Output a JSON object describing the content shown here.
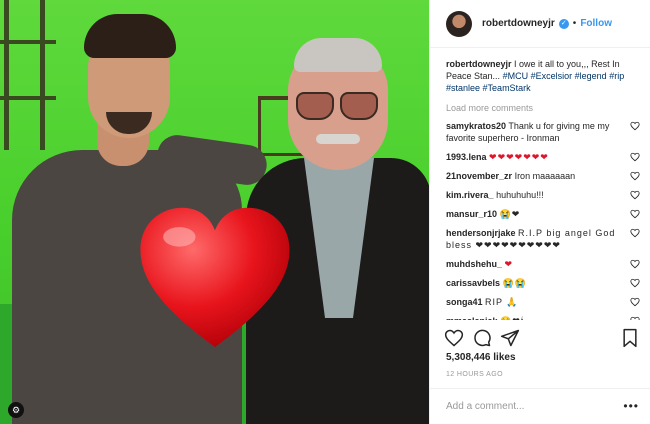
{
  "post": {
    "username": "robertdowneyjr",
    "verified_badge": "✓",
    "dot": "•",
    "follow_label": "Follow",
    "caption_text": "I owe it all to you,,, Rest In Peace Stan...",
    "caption_tags": [
      "#MCU",
      "#Excelsior",
      "#legend",
      "#rip",
      "#stanlee",
      "#TeamStark"
    ],
    "load_more": "Load more comments",
    "likes": "5,308,446 likes",
    "timestamp": "12 HOURS AGO",
    "add_comment_placeholder": "Add a comment...",
    "more_menu": "•••",
    "photo_badge": "⚙"
  },
  "comments": [
    {
      "user": "samykratos20",
      "text": "Thank u for giving me my favorite superhero - Ironman"
    },
    {
      "user": "1993.lena",
      "text": "❤❤❤❤❤❤❤"
    },
    {
      "user": "21november_zr",
      "text": "Iron maaaaaan"
    },
    {
      "user": "kim.rivera_",
      "text": "huhuhuhu!!!"
    },
    {
      "user": "mansur_r10",
      "text": "😭❤"
    },
    {
      "user": "hendersonjrjake",
      "text": "R.I.P big angel God bless ❤❤❤❤❤❤❤❤❤❤"
    },
    {
      "user": "muhdshehu_",
      "text": "❤"
    },
    {
      "user": "carissavbels",
      "text": "😭😭"
    },
    {
      "user": "songa41",
      "text": "RIP 🙏"
    },
    {
      "user": "mmaslenjak",
      "text": "😢❤🕯"
    }
  ],
  "colors": {
    "accent": "#3897f0",
    "green_screen": "#48cf2c",
    "heart": "#e0152a",
    "muted": "#999999"
  },
  "icons": [
    "heart-icon",
    "comment-icon",
    "share-icon",
    "bookmark-icon",
    "verified-icon",
    "more-icon"
  ]
}
